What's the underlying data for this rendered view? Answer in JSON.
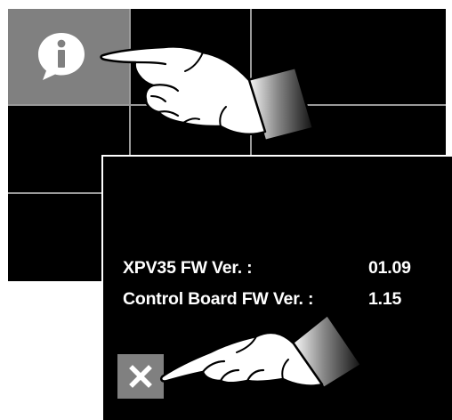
{
  "firmware_info": {
    "rows": [
      {
        "label": "XPV35 FW Ver. :",
        "value": "01.09"
      },
      {
        "label": "Control Board FW Ver. :",
        "value": "1.15"
      }
    ]
  },
  "icons": {
    "info": "info-bubble-icon",
    "close": "close-x-icon",
    "hands": "pointing-hand-icon"
  },
  "colors": {
    "screen_background": "#000000",
    "tile_gray": "#808080",
    "grid_line": "#9a9a9a",
    "text": "#ffffff"
  }
}
